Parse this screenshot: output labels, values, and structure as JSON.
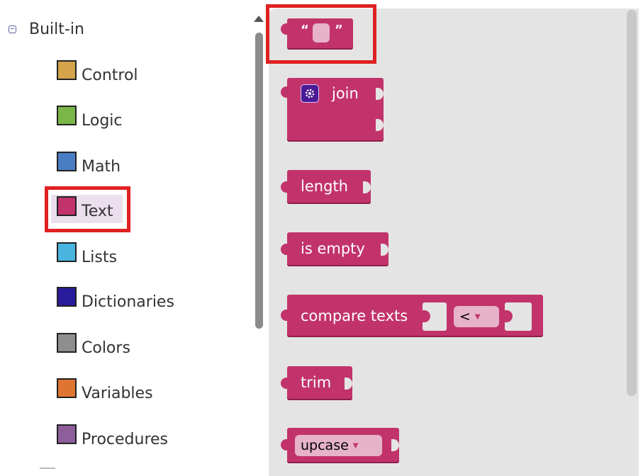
{
  "tree": {
    "root_label": "Built-in",
    "categories": [
      {
        "label": "Control",
        "color": "#d3a44a"
      },
      {
        "label": "Logic",
        "color": "#7ab648"
      },
      {
        "label": "Math",
        "color": "#4a7dc4"
      },
      {
        "label": "Text",
        "color": "#c2336b",
        "selected": true
      },
      {
        "label": "Lists",
        "color": "#49b4e0"
      },
      {
        "label": "Dictionaries",
        "color": "#2a1a9c"
      },
      {
        "label": "Colors",
        "color": "#8e8e8e"
      },
      {
        "label": "Variables",
        "color": "#e07531"
      },
      {
        "label": "Procedures",
        "color": "#8e5e9a"
      }
    ]
  },
  "flyout": {
    "text_block": {
      "open_quote": "“",
      "close_quote": "”"
    },
    "join_block": {
      "label": "join"
    },
    "length_block": {
      "label": "length"
    },
    "is_empty_block": {
      "label": "is empty"
    },
    "compare_block": {
      "label": "compare texts",
      "operator": "<"
    },
    "trim_block": {
      "label": "trim"
    },
    "upcase_block": {
      "label": "upcase"
    }
  },
  "colors": {
    "text_category": "#c2336b",
    "highlight": "#e02121"
  }
}
